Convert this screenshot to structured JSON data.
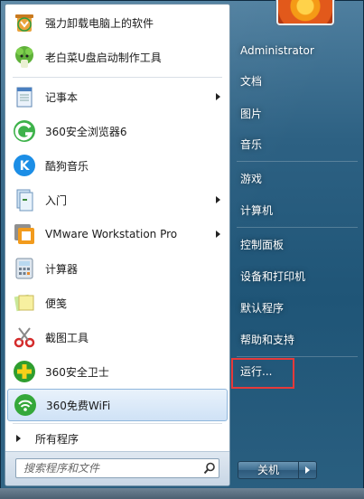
{
  "pinned": [
    {
      "label": "强力卸载电脑上的软件",
      "icon": "uninstall-bin-icon"
    },
    {
      "label": "老白菜U盘启动制作工具",
      "icon": "cabbage-icon"
    }
  ],
  "recent": [
    {
      "label": "记事本",
      "icon": "notepad-icon",
      "submenu": true
    },
    {
      "label": "360安全浏览器6",
      "icon": "browser-360-icon",
      "submenu": false
    },
    {
      "label": "酷狗音乐",
      "icon": "kugou-icon",
      "submenu": false
    },
    {
      "label": "入门",
      "icon": "getting-started-icon",
      "submenu": true
    },
    {
      "label": "VMware Workstation Pro",
      "icon": "vmware-icon",
      "submenu": true
    },
    {
      "label": "计算器",
      "icon": "calculator-icon",
      "submenu": false
    },
    {
      "label": "便笺",
      "icon": "sticky-notes-icon",
      "submenu": false
    },
    {
      "label": "截图工具",
      "icon": "snipping-tool-icon",
      "submenu": false
    },
    {
      "label": "360安全卫士",
      "icon": "security-360-icon",
      "submenu": false
    },
    {
      "label": "360免费WiFi",
      "icon": "wifi-360-icon",
      "submenu": false
    }
  ],
  "all_programs": "所有程序",
  "search": {
    "placeholder": "搜索程序和文件"
  },
  "right_items": [
    {
      "label": "Administrator"
    },
    {
      "label": "文档"
    },
    {
      "label": "图片"
    },
    {
      "label": "音乐"
    },
    {
      "label": "游戏"
    },
    {
      "label": "计算机"
    },
    {
      "label": "控制面板"
    },
    {
      "label": "设备和打印机"
    },
    {
      "label": "默认程序"
    },
    {
      "label": "帮助和支持"
    },
    {
      "label": "运行..."
    }
  ],
  "shutdown": {
    "label": "关机"
  }
}
